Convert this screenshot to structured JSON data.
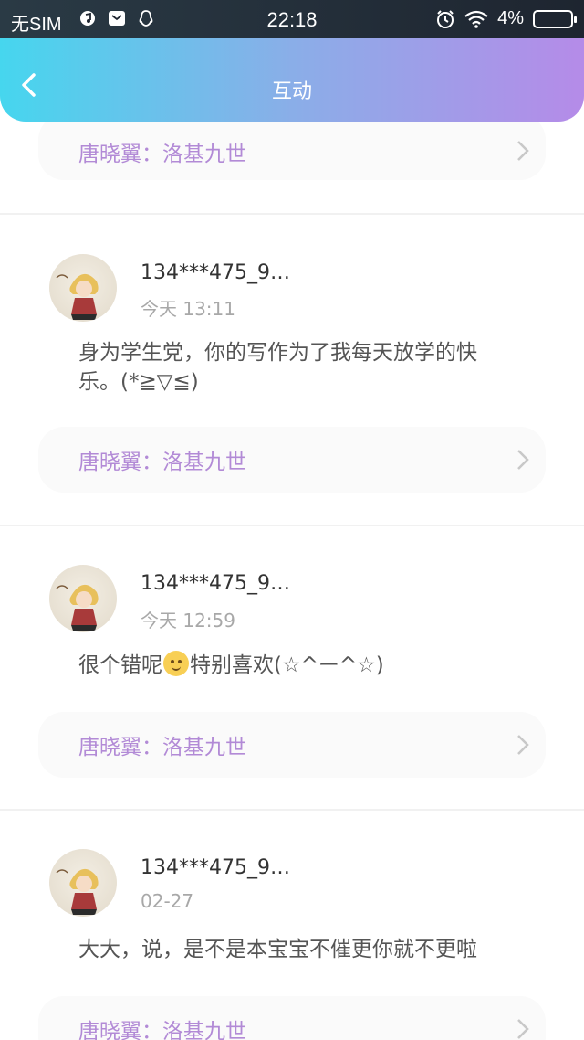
{
  "status_bar": {
    "carrier": "无SIM",
    "time": "22:18",
    "battery": "4%"
  },
  "header": {
    "title": "互动",
    "back_icon": "chevron-left-icon"
  },
  "book_link_label": "唐晓翼：洛基九世",
  "comments": [
    {
      "username": "134***475_9…",
      "time": "今天 13:11",
      "text": "身为学生党，你的写作为了我每天放学的快乐。(*≧▽≦)",
      "book": "唐晓翼：洛基九世"
    },
    {
      "username": "134***475_9…",
      "time": "今天 12:59",
      "text_before_emoji": "很个错呢",
      "emoji": "smile-emoji",
      "text_after_emoji": "特别喜欢(☆^ー^☆)",
      "book": "唐晓翼：洛基九世"
    },
    {
      "username": "134***475_9…",
      "time": "02-27",
      "text": "大大，说，是不是本宝宝不催更你就不更啦",
      "book": "唐晓翼：洛基九世"
    }
  ],
  "colors": {
    "header_gradient_start": "#46d6ee",
    "header_gradient_end": "#b58be8",
    "book_link_text": "#b28ad6"
  }
}
